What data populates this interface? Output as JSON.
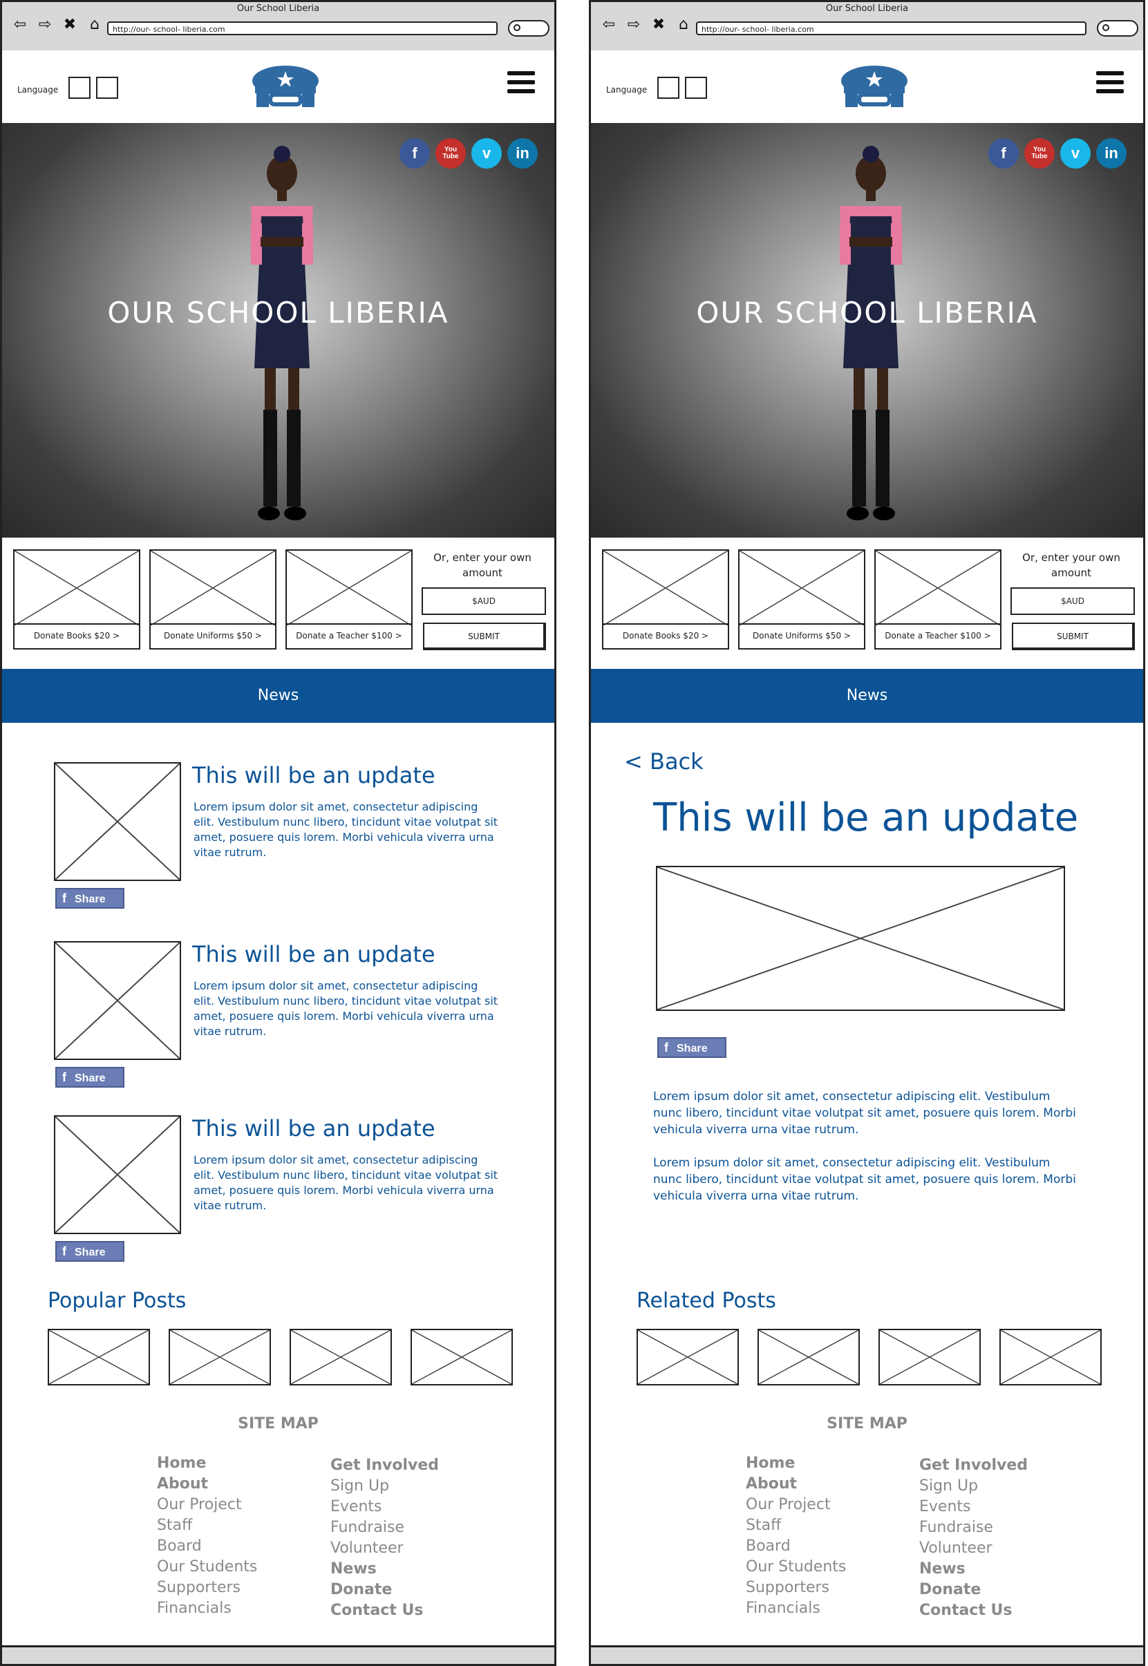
{
  "browser": {
    "title": "Our School Liberia",
    "url": "http://our- school- liberia.com",
    "nav_icons": [
      "back-arrow-icon",
      "forward-arrow-icon",
      "stop-icon",
      "home-icon"
    ]
  },
  "header": {
    "language_label": "Language",
    "logo_icon": "school-desk-star-logo",
    "menu_icon": "hamburger-menu-icon"
  },
  "hero": {
    "title": "OUR SCHOOL LIBERIA",
    "socials": [
      {
        "name": "facebook",
        "glyph": "f",
        "color": "#3b5998"
      },
      {
        "name": "youtube",
        "glyph": "You Tube",
        "color": "#c4302b"
      },
      {
        "name": "vimeo",
        "glyph": "v",
        "color": "#1ab7ea"
      },
      {
        "name": "linkedin",
        "glyph": "in",
        "color": "#0e76a8"
      }
    ]
  },
  "donate": {
    "cards": [
      "Donate Books $20 >",
      "Donate Uniforms $50 >",
      "Donate a Teacher $100 >"
    ],
    "own_amount_label": "Or, enter your own amount",
    "amount_placeholder": "$AUD",
    "submit_label": "SUBMIT"
  },
  "news_bar": {
    "label": "News"
  },
  "left_page": {
    "posts": [
      {
        "title": "This will be an update",
        "body": "Lorem ipsum dolor sit amet, consectetur adipiscing elit. Vestibulum nunc libero, tincidunt vitae volutpat sit amet, posuere quis lorem. Morbi vehicula viverra urna vitae rutrum.",
        "share": "Share"
      },
      {
        "title": "This will be an update",
        "body": "Lorem ipsum dolor sit amet, consectetur adipiscing elit. Vestibulum nunc libero, tincidunt vitae volutpat sit amet, posuere quis lorem. Morbi vehicula viverra urna vitae rutrum.",
        "share": "Share"
      },
      {
        "title": "This will be an update",
        "body": "Lorem ipsum dolor sit amet, consectetur adipiscing elit. Vestibulum nunc libero, tincidunt vitae volutpat sit amet, posuere quis lorem. Morbi vehicula viverra urna vitae rutrum.",
        "share": "Share"
      }
    ],
    "posts_section_title": "Popular Posts"
  },
  "right_page": {
    "back_label": "< Back",
    "article_title": "This will be an update",
    "share": "Share",
    "paragraphs": [
      "Lorem ipsum dolor sit amet, consectetur adipiscing elit. Vestibulum nunc libero, tincidunt vitae volutpat sit amet, posuere quis lorem. Morbi vehicula viverra urna vitae rutrum.",
      "Lorem ipsum dolor sit amet, consectetur adipiscing elit. Vestibulum nunc libero, tincidunt vitae volutpat sit amet, posuere quis lorem. Morbi vehicula viverra urna vitae rutrum."
    ],
    "posts_section_title": "Related Posts"
  },
  "sitemap": {
    "title": "SITE MAP",
    "col1": [
      {
        "label": "Home",
        "bold": true
      },
      {
        "label": "About",
        "bold": true
      },
      {
        "label": "Our Project",
        "bold": false
      },
      {
        "label": "Staff",
        "bold": false
      },
      {
        "label": "Board",
        "bold": false
      },
      {
        "label": "Our Students",
        "bold": false
      },
      {
        "label": "Supporters",
        "bold": false
      },
      {
        "label": "Financials",
        "bold": false
      }
    ],
    "col2": [
      {
        "label": "Get Involved",
        "bold": true
      },
      {
        "label": "Sign Up",
        "bold": false
      },
      {
        "label": "Events",
        "bold": false
      },
      {
        "label": "Fundraise",
        "bold": false
      },
      {
        "label": "Volunteer",
        "bold": false
      },
      {
        "label": "News",
        "bold": true
      },
      {
        "label": "Donate",
        "bold": true
      },
      {
        "label": "Contact Us",
        "bold": true
      }
    ]
  },
  "colors": {
    "brand_blue": "#0c5396",
    "chrome_gray": "#d8d8d8",
    "sitemap_gray": "#8a8a8a"
  }
}
